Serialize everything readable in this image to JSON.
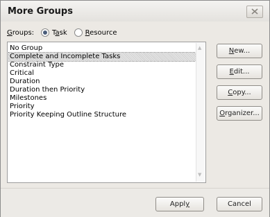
{
  "dialog": {
    "title": "More Groups",
    "close_icon": "close-icon"
  },
  "groups": {
    "label": "Groups:",
    "options": [
      {
        "label": "Task",
        "checked": true
      },
      {
        "label": "Resource",
        "checked": false
      }
    ]
  },
  "list": {
    "items": [
      "No Group",
      "Complete and Incomplete Tasks",
      "Constraint Type",
      "Critical",
      "Duration",
      "Duration then Priority",
      "Milestones",
      "Priority",
      "Priority Keeping Outline Structure"
    ],
    "selected_index": 1
  },
  "buttons": {
    "new": "New...",
    "edit": "Edit...",
    "copy": "Copy...",
    "organizer": "Organizer...",
    "apply": "Apply",
    "cancel": "Cancel"
  }
}
